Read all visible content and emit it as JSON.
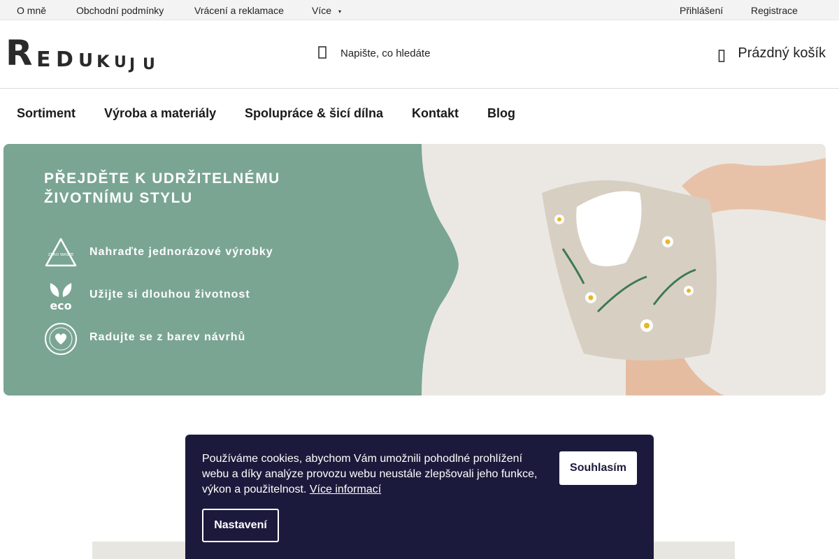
{
  "topbar": {
    "links": [
      "O mně",
      "Obchodní podmínky",
      "Vrácení a reklamace",
      "Více"
    ],
    "more_caret": "▾",
    "login": "Přihlášení",
    "register": "Registrace"
  },
  "header": {
    "logo_text": "REDUKUJU",
    "search_placeholder": "Napište, co hledáte",
    "cart_label": "Prázdný košík"
  },
  "nav": {
    "items": [
      "Sortiment",
      "Výroba a materiály",
      "Spolupráce & šicí dílna",
      "Kontakt",
      "Blog"
    ]
  },
  "banner": {
    "headline_line1": "PŘEJDĚTE K UDRŽITELNÉMU",
    "headline_line2": "ŽIVOTNÍMU STYLU",
    "features": [
      {
        "icon": "zero-waste-icon",
        "text": "Nahraďte jednorázové výrobky",
        "icon_label": "ZERO WASTE"
      },
      {
        "icon": "eco-leaf-icon",
        "text": "Užijte si dlouhou životnost",
        "icon_label": "eco"
      },
      {
        "icon": "handmade-heart-icon",
        "text": "Radujte se z barev návrhů",
        "icon_label": "HANDMADE WITH LOVE"
      }
    ],
    "green": "#7aa593"
  },
  "cookie": {
    "message": "Používáme cookies, abychom Vám umožnili pohodlné prohlížení webu a díky analýze provozu webu neustále zlepšovali jeho funkce, výkon a použitelnost.",
    "more_link": "Více informací",
    "agree_button": "Souhlasím",
    "settings_button": "Nastavení",
    "background": "#1c1a3c"
  }
}
